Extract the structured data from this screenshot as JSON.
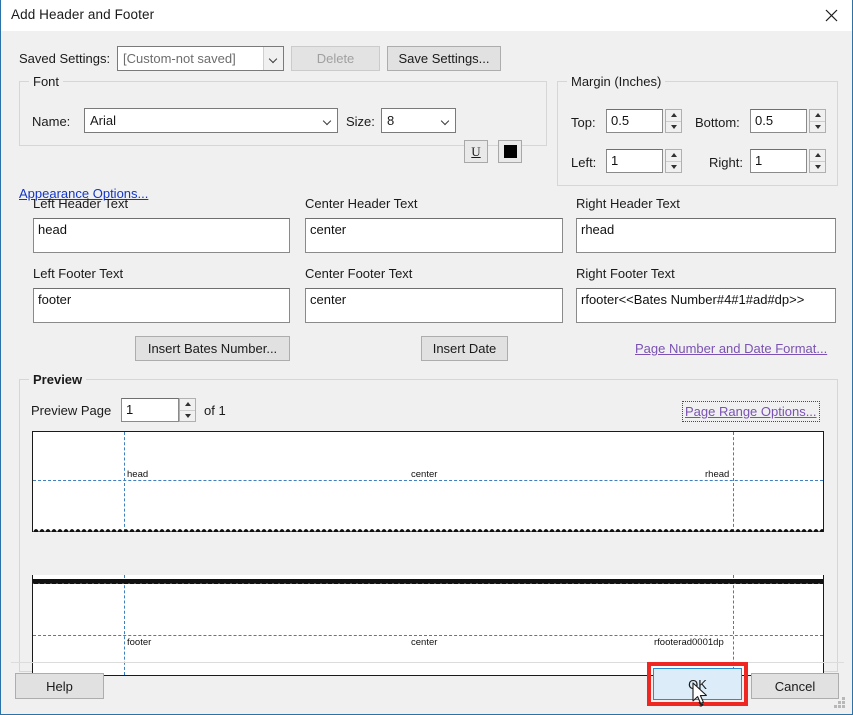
{
  "window": {
    "title": "Add Header and Footer",
    "close_icon": "close-icon"
  },
  "saved_settings": {
    "label": "Saved Settings:",
    "value": "[Custom-not saved]",
    "delete_label": "Delete",
    "save_label": "Save Settings..."
  },
  "font": {
    "group_title": "Font",
    "name_label": "Name:",
    "name_value": "Arial",
    "size_label": "Size:",
    "size_value": "8",
    "underline_label": "U",
    "color_swatch": "#000000",
    "appearance_link": "Appearance Options..."
  },
  "margin": {
    "group_title": "Margin (Inches)",
    "top_label": "Top:",
    "top_value": "0.5",
    "bottom_label": "Bottom:",
    "bottom_value": "0.5",
    "left_label": "Left:",
    "left_value": "1",
    "right_label": "Right:",
    "right_value": "1"
  },
  "text_fields": {
    "left_header_label": "Left Header Text",
    "left_header_value": "head",
    "center_header_label": "Center Header Text",
    "center_header_value": "center",
    "right_header_label": "Right Header Text",
    "right_header_value": "rhead",
    "left_footer_label": "Left Footer Text",
    "left_footer_value": "footer",
    "center_footer_label": "Center Footer Text",
    "center_footer_value": "center",
    "right_footer_label": "Right Footer Text",
    "right_footer_value": "rfooter<<Bates Number#4#1#ad#dp>>"
  },
  "insert_row": {
    "bates_label": "Insert Bates Number...",
    "date_label": "Insert Date",
    "format_link": "Page Number and Date Format..."
  },
  "preview": {
    "group_title": "Preview",
    "page_label": "Preview Page",
    "page_value": "1",
    "of_label": "of 1",
    "range_link": "Page Range Options...",
    "header_pane": {
      "left": "head",
      "center": "center",
      "right": "rhead"
    },
    "footer_pane": {
      "left": "footer",
      "center": "center",
      "right": "rfooterad0001dp"
    }
  },
  "footer_buttons": {
    "help_label": "Help",
    "ok_label": "OK",
    "cancel_label": "Cancel"
  },
  "colors": {
    "highlight": "#ee2722",
    "link": "#1435c4",
    "visited_link": "#7a52b3",
    "guide": "#3f7fbf",
    "ok_fill": "#dcecf8"
  }
}
